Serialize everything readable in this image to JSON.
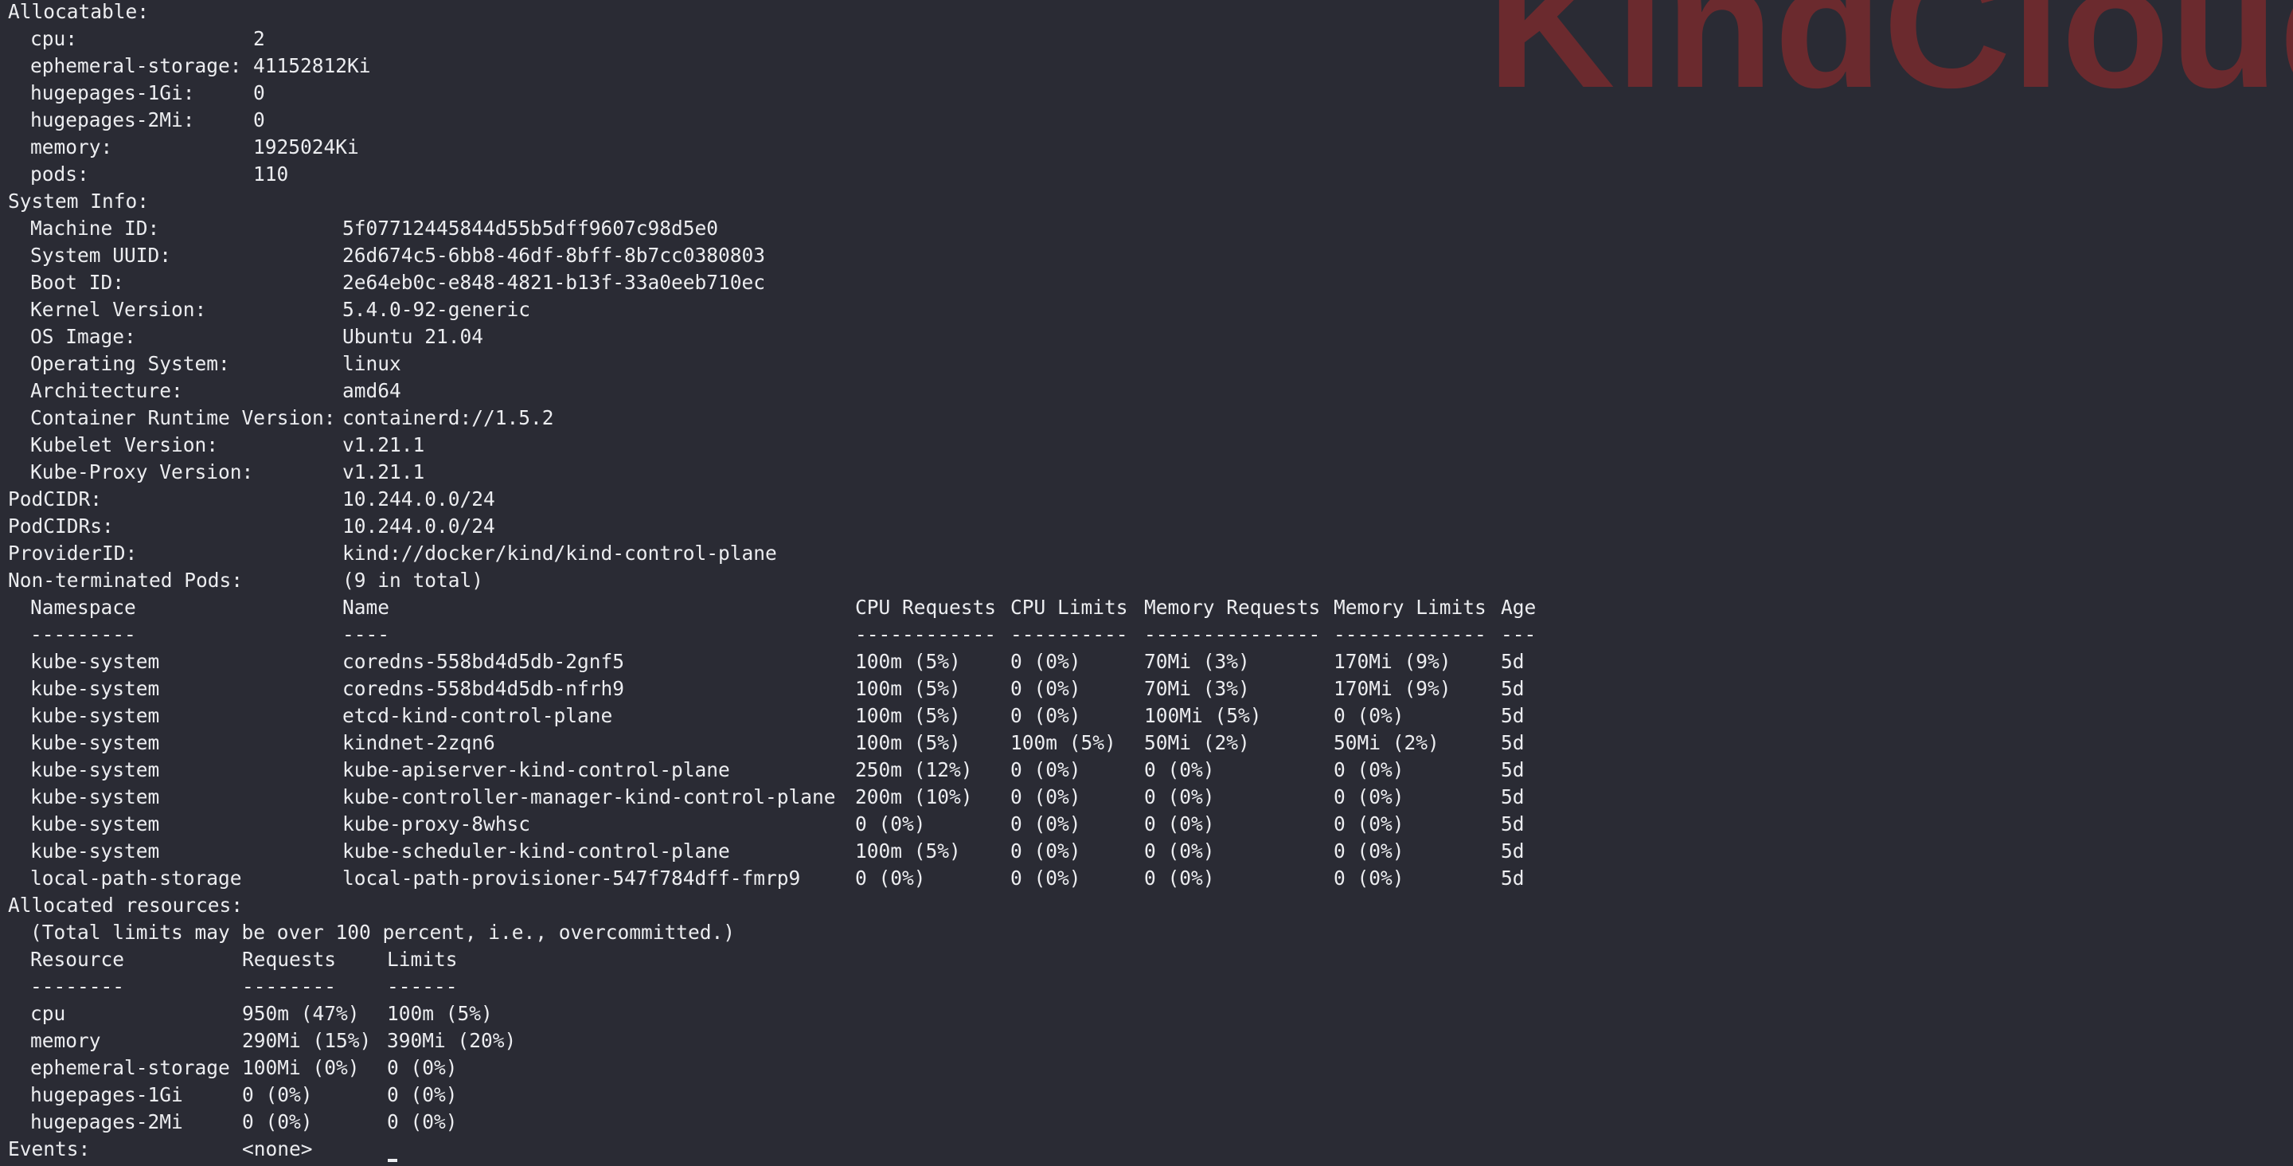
{
  "watermark": "KindCloud",
  "allocatable": {
    "heading": "Allocatable:",
    "rows": [
      {
        "key": "cpu:",
        "value": "2"
      },
      {
        "key": "ephemeral-storage:",
        "value": "41152812Ki"
      },
      {
        "key": "hugepages-1Gi:",
        "value": "0"
      },
      {
        "key": "hugepages-2Mi:",
        "value": "0"
      },
      {
        "key": "memory:",
        "value": "1925024Ki"
      },
      {
        "key": "pods:",
        "value": "110"
      }
    ]
  },
  "system_info": {
    "heading": "System Info:",
    "rows": [
      {
        "key": "Machine ID:",
        "value": "5f07712445844d55b5dff9607c98d5e0"
      },
      {
        "key": "System UUID:",
        "value": "26d674c5-6bb8-46df-8bff-8b7cc0380803"
      },
      {
        "key": "Boot ID:",
        "value": "2e64eb0c-e848-4821-b13f-33a0eeb710ec"
      },
      {
        "key": "Kernel Version:",
        "value": "5.4.0-92-generic"
      },
      {
        "key": "OS Image:",
        "value": "Ubuntu 21.04"
      },
      {
        "key": "Operating System:",
        "value": "linux"
      },
      {
        "key": "Architecture:",
        "value": "amd64"
      },
      {
        "key": "Container Runtime Version:",
        "value": "containerd://1.5.2"
      },
      {
        "key": "Kubelet Version:",
        "value": "v1.21.1"
      },
      {
        "key": "Kube-Proxy Version:",
        "value": "v1.21.1"
      }
    ]
  },
  "node_fields": [
    {
      "key": "PodCIDR:",
      "value": "10.244.0.0/24"
    },
    {
      "key": "PodCIDRs:",
      "value": "10.244.0.0/24"
    },
    {
      "key": "ProviderID:",
      "value": "kind://docker/kind/kind-control-plane"
    },
    {
      "key": "Non-terminated Pods:",
      "value": "(9 in total)"
    }
  ],
  "pods": {
    "headers": [
      "Namespace",
      "Name",
      "CPU Requests",
      "CPU Limits",
      "Memory Requests",
      "Memory Limits",
      "Age"
    ],
    "dashes": [
      "---------",
      "----",
      "------------",
      "----------",
      "---------------",
      "-------------",
      "---"
    ],
    "rows": [
      [
        "kube-system",
        "coredns-558bd4d5db-2gnf5",
        "100m (5%)",
        "0 (0%)",
        "70Mi (3%)",
        "170Mi (9%)",
        "5d"
      ],
      [
        "kube-system",
        "coredns-558bd4d5db-nfrh9",
        "100m (5%)",
        "0 (0%)",
        "70Mi (3%)",
        "170Mi (9%)",
        "5d"
      ],
      [
        "kube-system",
        "etcd-kind-control-plane",
        "100m (5%)",
        "0 (0%)",
        "100Mi (5%)",
        "0 (0%)",
        "5d"
      ],
      [
        "kube-system",
        "kindnet-2zqn6",
        "100m (5%)",
        "100m (5%)",
        "50Mi (2%)",
        "50Mi (2%)",
        "5d"
      ],
      [
        "kube-system",
        "kube-apiserver-kind-control-plane",
        "250m (12%)",
        "0 (0%)",
        "0 (0%)",
        "0 (0%)",
        "5d"
      ],
      [
        "kube-system",
        "kube-controller-manager-kind-control-plane",
        "200m (10%)",
        "0 (0%)",
        "0 (0%)",
        "0 (0%)",
        "5d"
      ],
      [
        "kube-system",
        "kube-proxy-8whsc",
        "0 (0%)",
        "0 (0%)",
        "0 (0%)",
        "0 (0%)",
        "5d"
      ],
      [
        "kube-system",
        "kube-scheduler-kind-control-plane",
        "100m (5%)",
        "0 (0%)",
        "0 (0%)",
        "0 (0%)",
        "5d"
      ],
      [
        "local-path-storage",
        "local-path-provisioner-547f784dff-fmrp9",
        "0 (0%)",
        "0 (0%)",
        "0 (0%)",
        "0 (0%)",
        "5d"
      ]
    ]
  },
  "allocated": {
    "heading": "Allocated resources:",
    "note": "(Total limits may be over 100 percent, i.e., overcommitted.)",
    "headers": [
      "Resource",
      "Requests",
      "Limits"
    ],
    "dashes": [
      "--------",
      "--------",
      "------"
    ],
    "rows": [
      [
        "cpu",
        "950m (47%)",
        "100m (5%)"
      ],
      [
        "memory",
        "290Mi (15%)",
        "390Mi (20%)"
      ],
      [
        "ephemeral-storage",
        "100Mi (0%)",
        "0 (0%)"
      ],
      [
        "hugepages-1Gi",
        "0 (0%)",
        "0 (0%)"
      ],
      [
        "hugepages-2Mi",
        "0 (0%)",
        "0 (0%)"
      ]
    ]
  },
  "events": {
    "key": "Events:",
    "value": "<none>"
  }
}
